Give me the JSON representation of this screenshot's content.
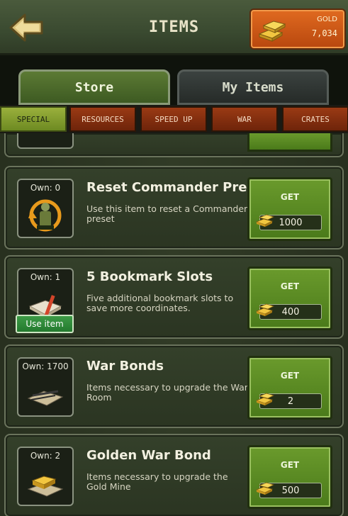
{
  "header": {
    "title": "ITEMS",
    "gold_label": "GOLD",
    "gold_value": "7,034"
  },
  "tabs": [
    {
      "label": "Store",
      "active": true
    },
    {
      "label": "My Items",
      "active": false
    }
  ],
  "categories": [
    {
      "label": "SPECIAL",
      "active": true
    },
    {
      "label": "RESOURCES",
      "active": false
    },
    {
      "label": "SPEED UP",
      "active": false
    },
    {
      "label": "WAR",
      "active": false
    },
    {
      "label": "CRATES",
      "active": false
    }
  ],
  "items": [
    {
      "own": "Own: 0",
      "name": "Reset Commander Preset",
      "description": "Use this item to reset a Commander preset",
      "get_label": "GET",
      "price": "1000",
      "icon": "commander-preset-icon"
    },
    {
      "own": "Own: 1",
      "name": "5 Bookmark Slots",
      "description": "Five additional bookmark slots to save more coordinates.",
      "get_label": "GET",
      "price": "400",
      "use_label": "Use item",
      "icon": "book-icon"
    },
    {
      "own": "Own: 1700",
      "name": "War Bonds",
      "description": "Items necessary to upgrade the War Room",
      "get_label": "GET",
      "price": "2",
      "icon": "war-bonds-icon"
    },
    {
      "own": "Own: 2",
      "name": "Golden War Bond",
      "description": "Items necessary to upgrade the Gold Mine",
      "get_label": "GET",
      "price": "500",
      "icon": "golden-war-bond-icon"
    }
  ],
  "colors": {
    "header": "#3a4a30",
    "gold_button": "#d45a18",
    "active_tab": "#5c7a34",
    "get_button": "#5a8a24",
    "category_default": "#8a3212",
    "category_active": "#8aa232"
  }
}
